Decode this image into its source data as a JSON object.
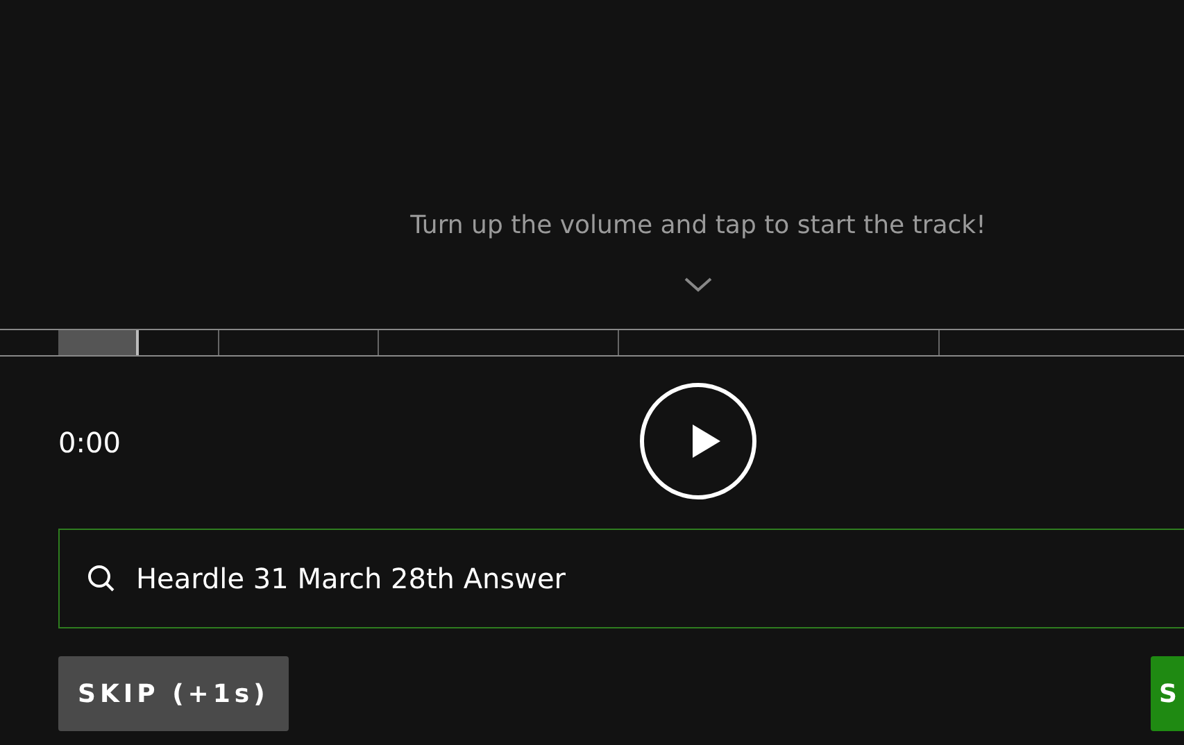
{
  "hint": "Turn up the volume and tap to start the track!",
  "segments": [
    {
      "selected": true
    },
    {
      "selected": false
    },
    {
      "selected": false
    },
    {
      "selected": false
    },
    {
      "selected": false
    }
  ],
  "time": "0:00",
  "search": {
    "value": "Heardle 31 March 28th Answer"
  },
  "skip_button": "SKIP (+1s)",
  "submit_button": "S"
}
